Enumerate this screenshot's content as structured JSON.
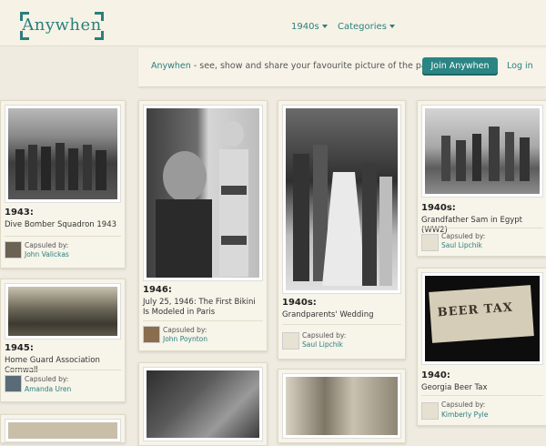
{
  "header": {
    "logo": "Anywhen",
    "nav": [
      {
        "label": "1940s"
      },
      {
        "label": "Categories"
      }
    ]
  },
  "banner": {
    "brand": "Anywhen",
    "tagline": " - see, show and share your favourite picture of the past.",
    "join_label": "Join Anywhen",
    "login_label": "Log in"
  },
  "cards": [
    {
      "year": "1943:",
      "title": "Dive Bomber Squadron 1943",
      "captioned_by": "Capsuled by:",
      "user": "John Valickas"
    },
    {
      "year": "1945:",
      "title": "Home Guard Association Cornwall",
      "captioned_by": "Capsuled by:",
      "user": "Amanda Uren"
    },
    {
      "year": "1946:",
      "title": "July 25, 1946: The First Bikini Is Modeled in Paris",
      "captioned_by": "Capsuled by:",
      "user": "John Poynton"
    },
    {
      "year": "1940s:",
      "title": "Grandparents' Wedding",
      "captioned_by": "Capsuled by:",
      "user": "Saul Lipchik"
    },
    {
      "year": "1940s:",
      "title": "Grandfather Sam in Egypt (WW2)",
      "captioned_by": "Capsuled by:",
      "user": "Saul Lipchik"
    },
    {
      "year": "1940:",
      "title": "Georgia Beer Tax",
      "captioned_by": "Capsuled by:",
      "user": "Kimberly Pyle",
      "photo_text": "BEER TAX"
    }
  ]
}
